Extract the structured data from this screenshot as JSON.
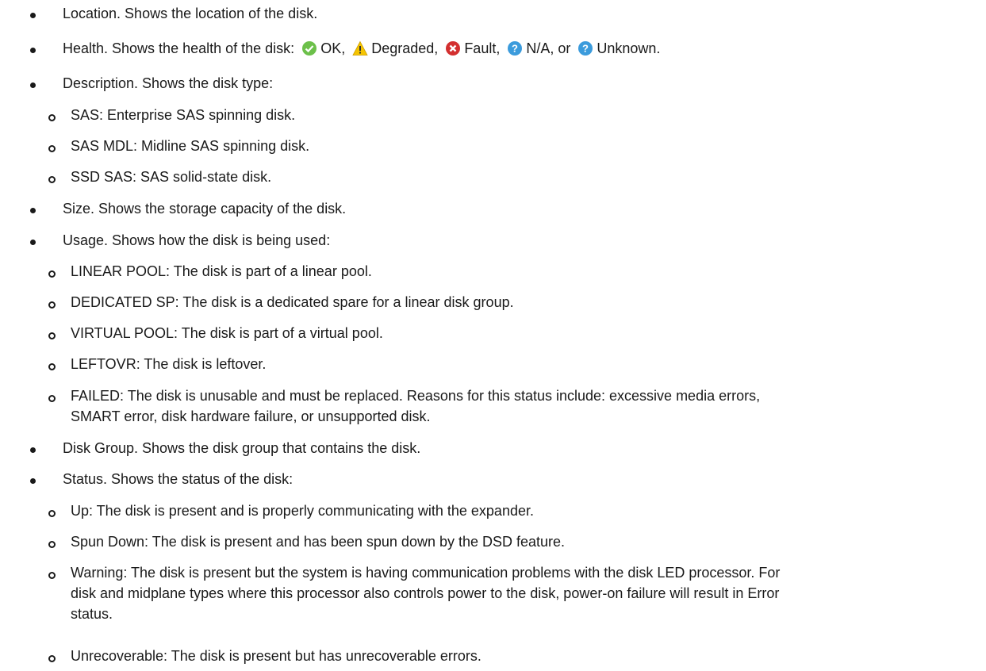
{
  "items": [
    {
      "text": "Location. Shows the location of the disk."
    },
    {
      "prefix": "Health. Shows the health of the disk:",
      "ok": "OK,",
      "degraded": "Degraded,",
      "fault": "Fault,",
      "na": "N/A, or",
      "unknown": "Unknown."
    },
    {
      "text": "Description. Shows the disk type:"
    },
    {
      "text": "SAS: Enterprise SAS spinning disk."
    },
    {
      "text": "SAS MDL: Midline SAS spinning disk."
    },
    {
      "text": "SSD SAS: SAS solid-state disk."
    },
    {
      "text": "Size. Shows the storage capacity of the disk."
    },
    {
      "text": "Usage. Shows how the disk is being used:"
    },
    {
      "text": "LINEAR POOL: The disk is part of a linear pool."
    },
    {
      "text": "DEDICATED SP: The disk is a dedicated spare for a linear disk group."
    },
    {
      "text": "VIRTUAL POOL: The disk is part of a virtual pool."
    },
    {
      "text": "LEFTOVR: The disk is leftover."
    },
    {
      "line1": "FAILED: The disk is unusable and must be replaced. Reasons for this status include: excessive media errors,",
      "line2": "SMART error, disk hardware failure, or unsupported disk."
    },
    {
      "text": "Disk Group. Shows the disk group that contains the disk."
    },
    {
      "text": "Status. Shows the status of the disk:"
    },
    {
      "text": "Up: The disk is present and is properly communicating with the expander."
    },
    {
      "text": "Spun Down: The disk is present and has been spun down by the DSD feature."
    },
    {
      "line1": "Warning: The disk is present but the system is having communication problems with the disk LED processor. For",
      "line2": "disk and midplane types where this processor also controls power to the disk, power-on failure will result in Error",
      "line3": "status."
    },
    {
      "text": "Unrecoverable: The disk is present but has unrecoverable errors."
    }
  ],
  "icons": {
    "ok": "check-circle-icon",
    "degraded": "warning-triangle-icon",
    "fault": "x-circle-icon",
    "na": "question-circle-icon",
    "unknown": "question-circle-icon"
  },
  "colors": {
    "ok": "#6cc04a",
    "degraded": "#f5c400",
    "fault": "#d32f2f",
    "info": "#3b9bdc"
  }
}
